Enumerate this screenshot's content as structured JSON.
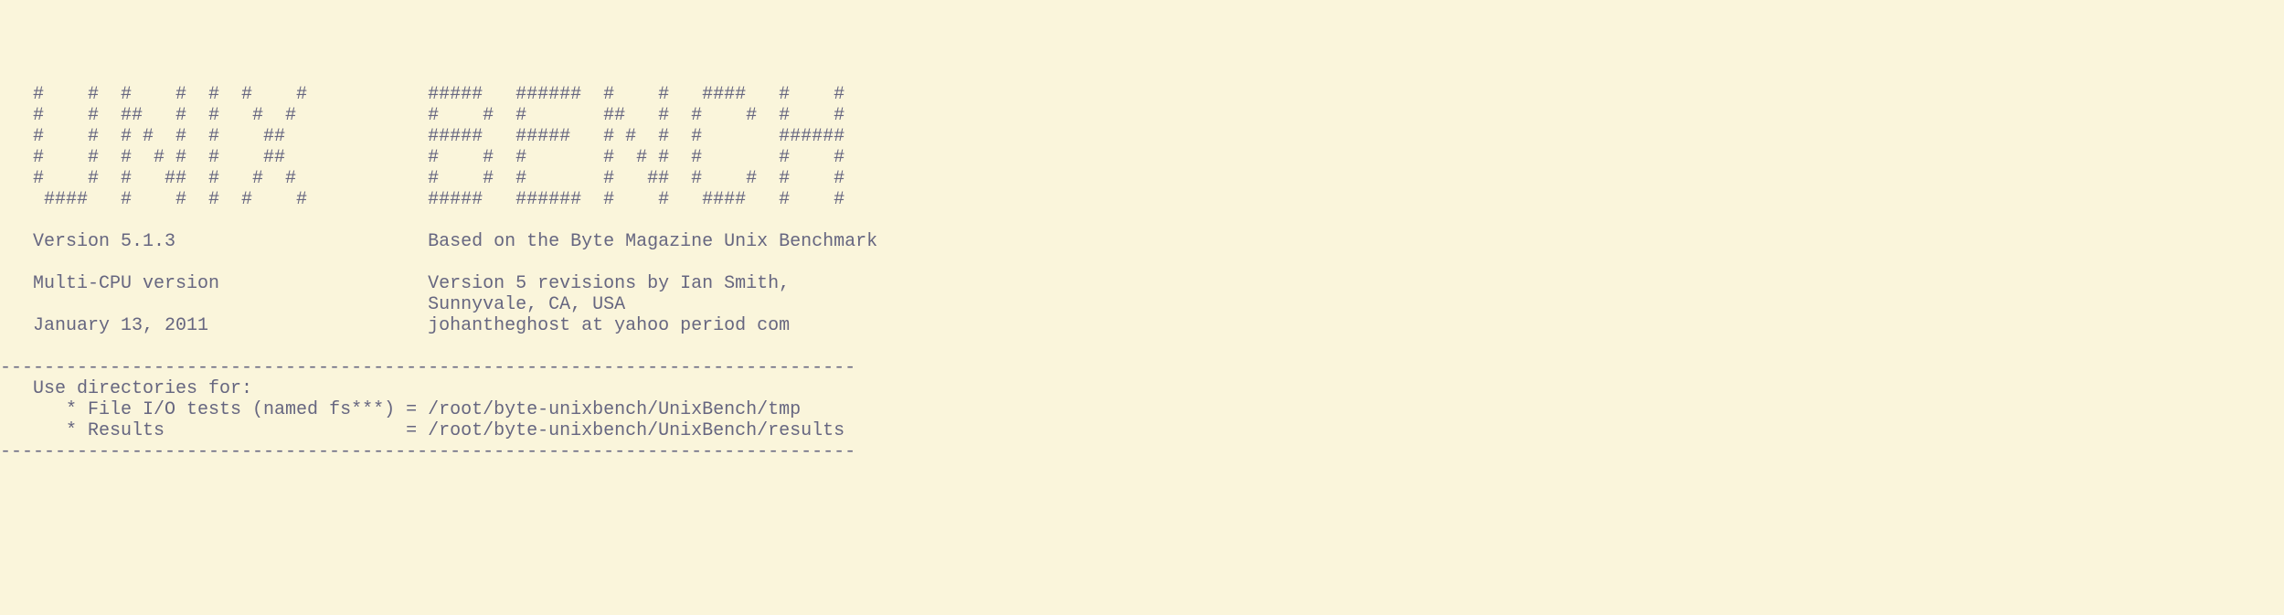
{
  "terminal": {
    "ascii_art": [
      "   #    #  #    #  #  #    #",
      "   #    #  ##   #  #   #  #",
      "   #    #  # #  #  #    ##",
      "   #    #  #  # #  #    ##",
      "   #    #  #   ##  #   #  #",
      "    ####   #    #  #  #    #"
    ],
    "ascii_art_right": [
      "#####   ######  #    #   ####   #    #",
      "#    #  #       ##   #  #    #  #    #",
      "#####   #####   # #  #  #       ######",
      "#    #  #       #  # #  #       #    #",
      "#    #  #       #   ##  #    #  #    #",
      "#####   ######  #    #   ####   #    #"
    ],
    "version_label": "Version 5.1.3",
    "based_on": "Based on the Byte Magazine Unix Benchmark",
    "multi_cpu": "Multi-CPU version",
    "version5_revisions": "Version 5 revisions by Ian Smith,",
    "location": "Sunnyvale, CA, USA",
    "date": "January 13, 2011",
    "email": "johantheghost at yahoo period com",
    "divider": "------------------------------------------------------------------------------",
    "use_directories": "Use directories for:",
    "fileio_label": "* File I/O tests (named fs***)",
    "fileio_path": "/root/byte-unixbench/UnixBench/tmp",
    "results_label": "* Results",
    "results_path": "/root/byte-unixbench/UnixBench/results"
  }
}
